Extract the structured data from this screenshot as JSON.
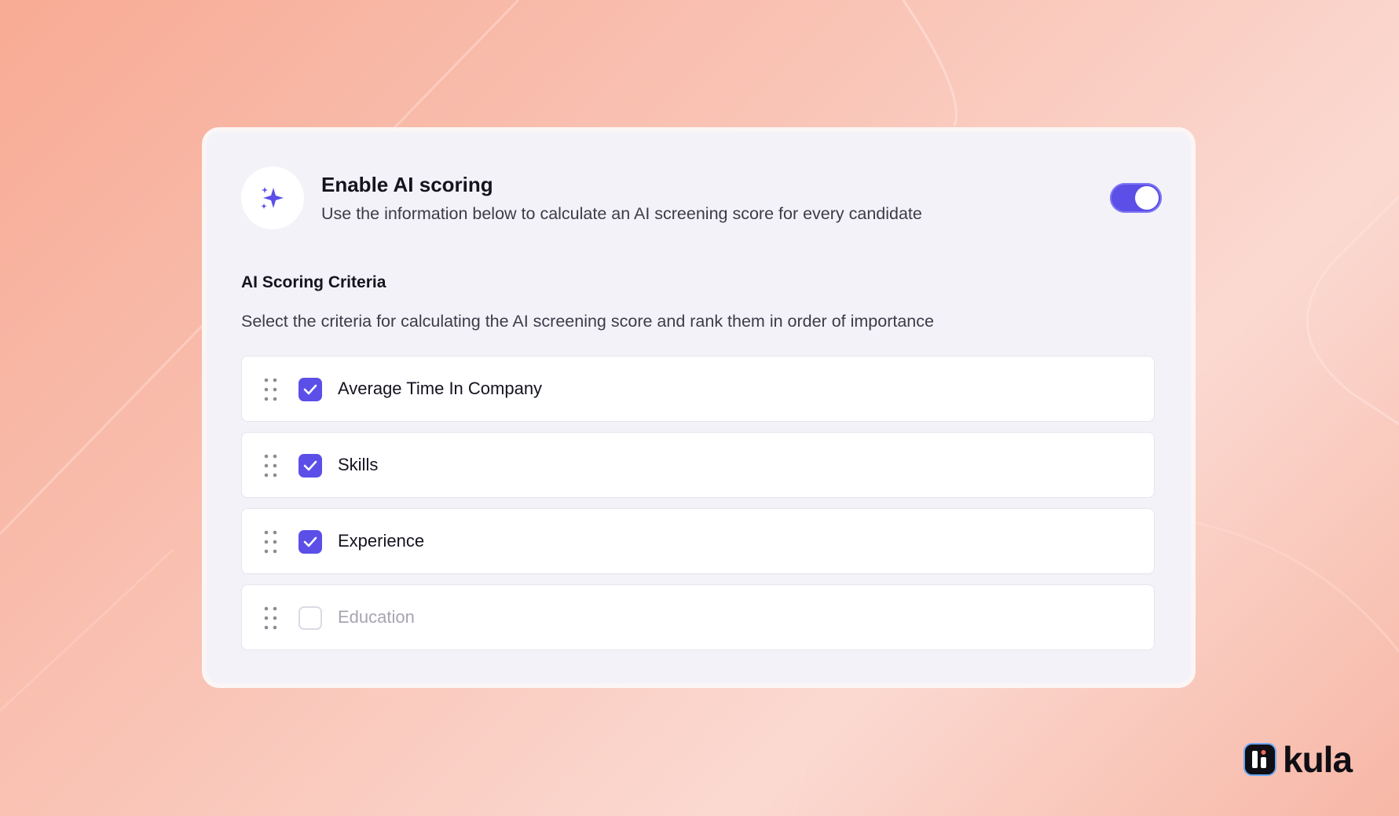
{
  "header": {
    "icon": "sparkles-icon",
    "title": "Enable AI scoring",
    "description": "Use the information below to calculate an AI screening score for every candidate",
    "toggle_on": true
  },
  "criteria_section": {
    "title": "AI Scoring Criteria",
    "description": "Select the criteria for calculating the AI screening score and rank them in order of importance",
    "items": [
      {
        "label": "Average Time In Company",
        "checked": true
      },
      {
        "label": "Skills",
        "checked": true
      },
      {
        "label": "Experience",
        "checked": true
      },
      {
        "label": "Education",
        "checked": false
      }
    ]
  },
  "brand": {
    "name": "kula"
  },
  "colors": {
    "accent": "#5b4fe8",
    "card_background": "#f3f2f8",
    "page_background": "#f8b6a3",
    "text_primary": "#15131f",
    "text_muted": "#a7a5b0"
  }
}
